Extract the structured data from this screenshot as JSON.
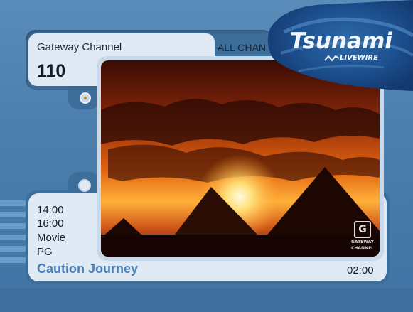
{
  "channel": {
    "name": "Gateway Channel",
    "number": "110",
    "filter": "ALL CHAN"
  },
  "brand": {
    "name": "Tsunami",
    "sub": "LIVEWIRE"
  },
  "program": {
    "start": "14:00",
    "end": "16:00",
    "genre": "Movie",
    "rating": "PG",
    "title": "Caution Journey",
    "duration": "02:00"
  },
  "watermark": {
    "letter": "G",
    "line1": "GATEWAY",
    "line2": "CHANNEL"
  },
  "colors": {
    "background": "#4a7fae",
    "panel": "#dfeaf5",
    "title_accent": "#4b7fb3"
  }
}
